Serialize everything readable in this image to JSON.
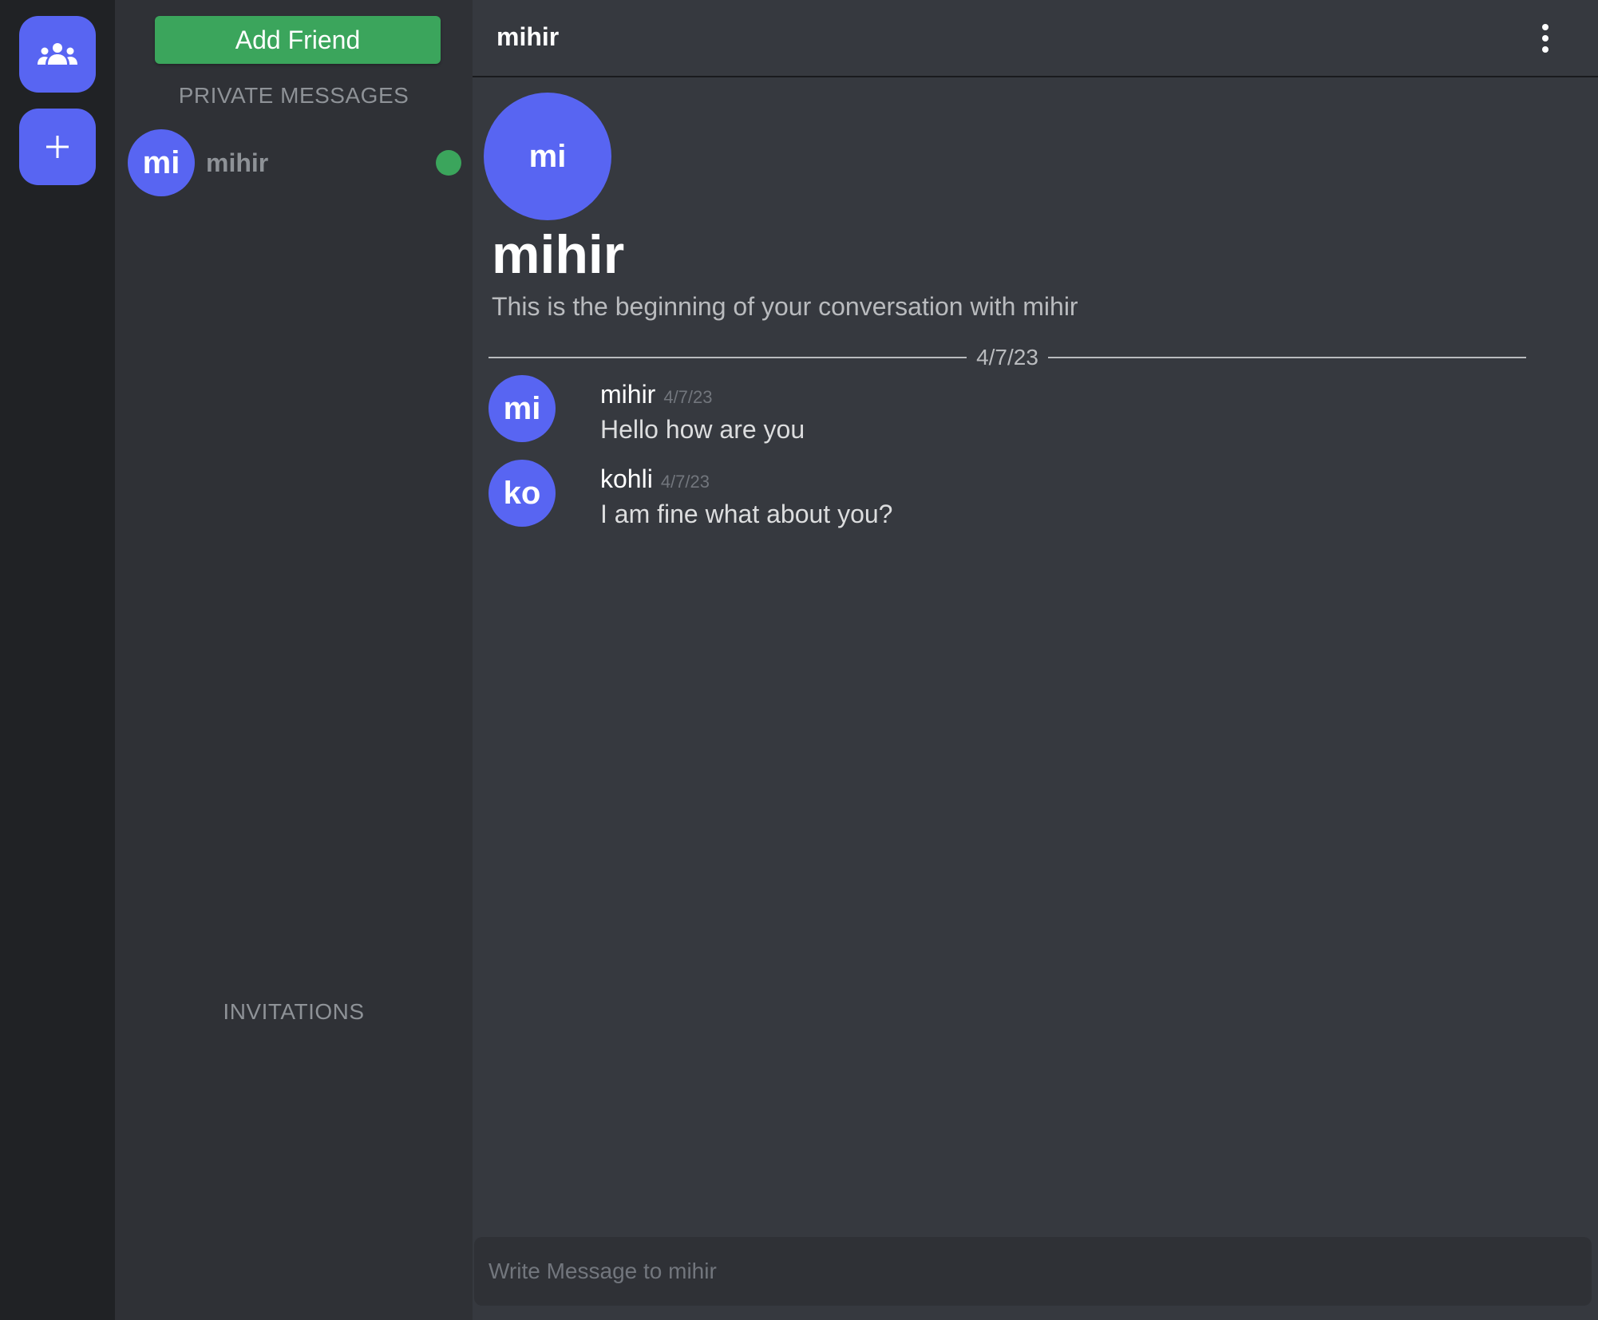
{
  "rail": {
    "friends_icon": "friends-icon",
    "add_icon": "plus-icon"
  },
  "sidebar": {
    "add_friend_label": "Add Friend",
    "private_messages_title": "PRIVATE MESSAGES",
    "dms": [
      {
        "initials": "mi",
        "name": "mihir",
        "online": true
      }
    ],
    "invitations_title": "INVITATIONS"
  },
  "header": {
    "title": "mihir",
    "menu_icon": "kebab-menu-icon"
  },
  "conversation": {
    "avatar_initials": "mi",
    "name": "mihir",
    "intro": "This is the beginning of your conversation with mihir",
    "date_divider": "4/7/23",
    "messages": [
      {
        "initials": "mi",
        "author": "mihir",
        "time": "4/7/23",
        "text": "Hello how are you"
      },
      {
        "initials": "ko",
        "author": "kohli",
        "time": "4/7/23",
        "text": "I am fine what about you?"
      }
    ]
  },
  "composer": {
    "placeholder": "Write Message to mihir",
    "value": ""
  },
  "colors": {
    "accent": "#5865f2",
    "online": "#3ba55c",
    "add_friend_bg": "#3ba55c",
    "rail_bg": "#202225",
    "sidebar_bg": "#2f3136",
    "main_bg": "#36393f"
  }
}
